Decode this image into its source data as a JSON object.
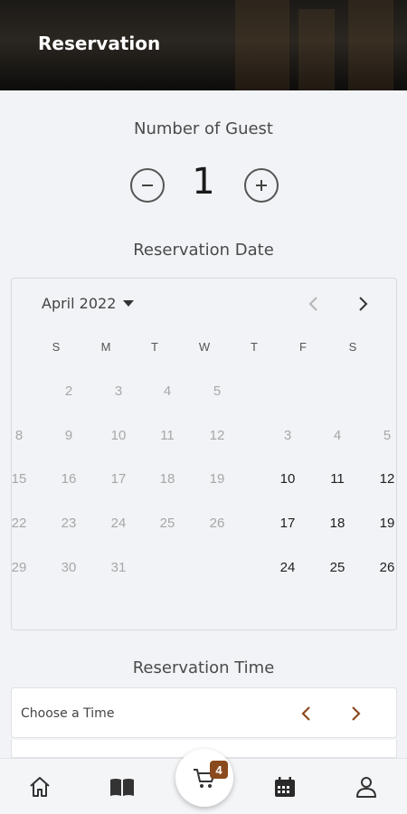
{
  "header": {
    "title": "Reservation"
  },
  "guests": {
    "title": "Number of Guest",
    "count": "1"
  },
  "date": {
    "title": "Reservation Date",
    "month_label": "April 2022",
    "weekdays": [
      "S",
      "M",
      "T",
      "W",
      "T",
      "F",
      "S"
    ],
    "rows": [
      {
        "cells": [
          "",
          "2",
          "3",
          "4",
          "5",
          "",
          "",
          ""
        ]
      },
      {
        "cells": [
          "8",
          "9",
          "10",
          "11",
          "12",
          "",
          "3",
          "4",
          "5"
        ]
      },
      {
        "cells": [
          "15",
          "16",
          "17",
          "18",
          "19",
          "",
          "10",
          "11",
          "12"
        ]
      },
      {
        "cells": [
          "22",
          "23",
          "24",
          "25",
          "26",
          "",
          "17",
          "18",
          "19"
        ]
      },
      {
        "cells": [
          "29",
          "30",
          "31",
          "",
          "",
          "",
          "24",
          "25",
          "26"
        ]
      }
    ]
  },
  "time": {
    "title": "Reservation Time",
    "placeholder": "Choose a Time"
  },
  "nav": {
    "cart_count": "4"
  },
  "colors": {
    "accent": "#8b4a1e",
    "header_bg": "#1c1a17",
    "background": "#f1f3f6"
  }
}
